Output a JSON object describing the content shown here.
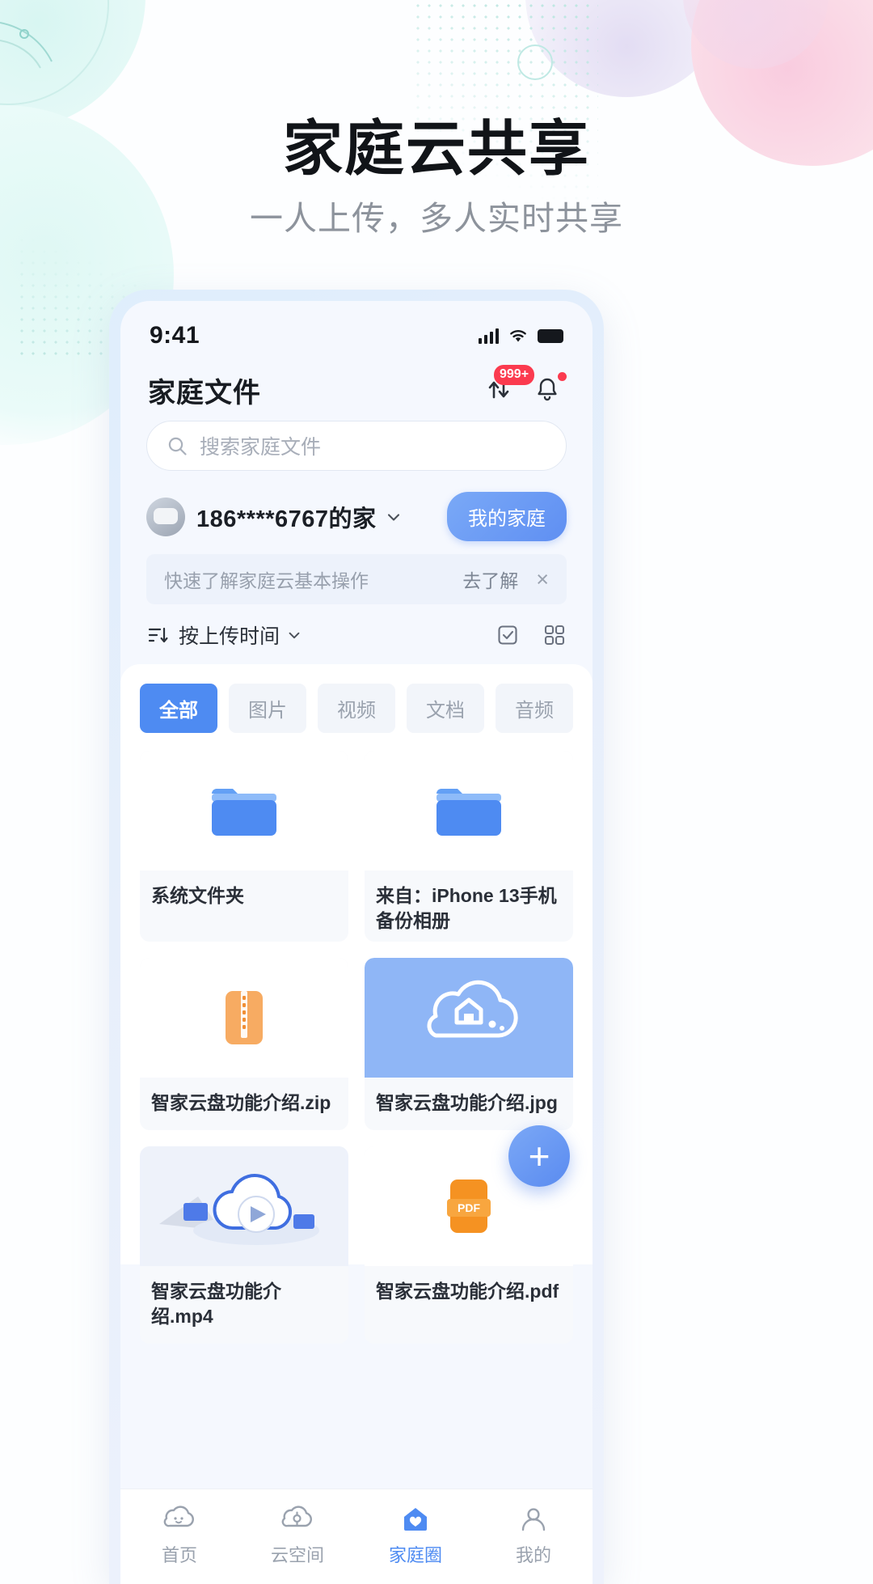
{
  "hero": {
    "title": "家庭云共享",
    "subtitle": "一人上传，多人实时共享"
  },
  "colors": {
    "accent": "#4e8bf2",
    "badge_red": "#fb3b4f",
    "folder_blue": "#4e8bf2",
    "zip_orange": "#f5a05a",
    "pdf_orange": "#f59222",
    "muted_text": "#9aa2ae"
  },
  "phone": {
    "statusbar": {
      "time": "9:41",
      "signal_icon": "cellular-signal-icon",
      "wifi_icon": "wifi-icon",
      "battery_icon": "battery-full-icon"
    },
    "appbar": {
      "title": "家庭文件",
      "transfer_icon": "transfer-updown-icon",
      "transfer_badge": "999+",
      "bell_icon": "bell-icon"
    },
    "search": {
      "placeholder": "搜索家庭文件",
      "value": "",
      "icon": "search-icon"
    },
    "account": {
      "avatar": "user-avatar",
      "name": "186****6767的家",
      "chevron": "chevron-down-icon",
      "family_button": "我的家庭"
    },
    "tip": {
      "text": "快速了解家庭云基本操作",
      "link": "去了解",
      "close": "×"
    },
    "sort": {
      "icon": "sort-icon",
      "label": "按上传时间",
      "chevron": "chevron-down-icon",
      "select_icon": "multi-select-icon",
      "layout_icon": "grid-layout-icon"
    },
    "filters": [
      {
        "label": "全部",
        "active": true
      },
      {
        "label": "图片",
        "active": false
      },
      {
        "label": "视频",
        "active": false
      },
      {
        "label": "文档",
        "active": false
      },
      {
        "label": "音频",
        "active": false
      }
    ],
    "files": [
      {
        "name": "系统文件夹",
        "kind": "folder",
        "icon": "folder-icon"
      },
      {
        "name": "来自：iPhone 13手机备份相册",
        "kind": "folder",
        "icon": "folder-icon"
      },
      {
        "name": "智家云盘功能介绍.zip",
        "kind": "zip",
        "icon": "zip-file-icon"
      },
      {
        "name": "智家云盘功能介绍.jpg",
        "kind": "image",
        "icon": "cloud-house-image"
      },
      {
        "name": "智家云盘功能介绍.mp4",
        "kind": "video",
        "icon": "video-play-icon"
      },
      {
        "name": "智家云盘功能介绍.pdf",
        "kind": "pdf",
        "icon": "pdf-file-icon"
      }
    ],
    "fab": {
      "label": "+",
      "icon": "plus-icon"
    },
    "tabs": [
      {
        "label": "首页",
        "icon": "home-cloud-icon",
        "active": false
      },
      {
        "label": "云空间",
        "icon": "cloud-space-icon",
        "active": false
      },
      {
        "label": "家庭圈",
        "icon": "family-circle-icon",
        "active": true
      },
      {
        "label": "我的",
        "icon": "person-icon",
        "active": false
      }
    ]
  }
}
